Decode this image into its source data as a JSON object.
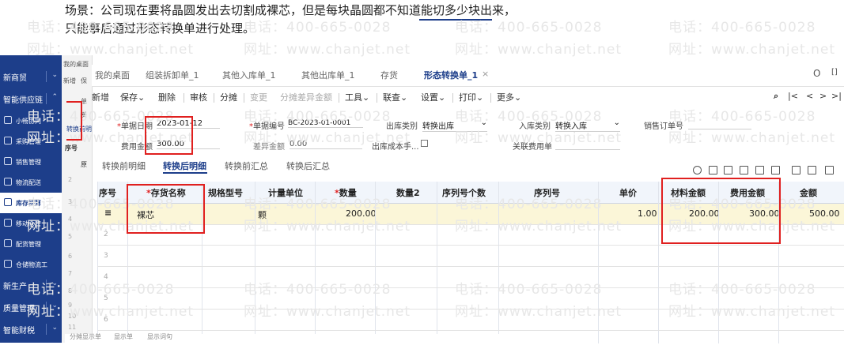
{
  "caption": {
    "line1": "场景：公司现在要将晶圆发出去切割成裸芯，但是每块晶圆都不知道能切多少块出来，",
    "line2": "只能事后通过形态转换单进行处理。"
  },
  "watermark": {
    "phone": "电话：400-665-0028",
    "site": "网址：www.chanjet.net"
  },
  "sidebar": {
    "items": [
      {
        "label": "新商贸",
        "type": "top"
      },
      {
        "label": "智能供应链",
        "type": "top"
      },
      {
        "label": "小畅协同",
        "type": "sub"
      },
      {
        "label": "采购管理",
        "type": "sub"
      },
      {
        "label": "销售管理",
        "type": "sub"
      },
      {
        "label": "物流配送",
        "type": "sub"
      },
      {
        "label": "库存核算",
        "type": "sub-active"
      },
      {
        "label": "移动仓管",
        "type": "sub"
      },
      {
        "label": "配货管理",
        "type": "sub"
      },
      {
        "label": "仓储物流工",
        "type": "sub"
      },
      {
        "label": "新生产",
        "type": "top"
      },
      {
        "label": "质量管理",
        "type": "top"
      },
      {
        "label": "智能财税",
        "type": "top"
      }
    ],
    "strip_labels": [
      "我的桌面",
      "新增",
      "保",
      "单",
      "费",
      "转换前明",
      "序号",
      "原",
      "2",
      "3",
      "4",
      "5",
      "6",
      "7",
      "8",
      "9",
      "10",
      "11"
    ]
  },
  "tabs": [
    {
      "label": "我的桌面"
    },
    {
      "label": "组装拆卸单_1"
    },
    {
      "label": "其他入库单_1"
    },
    {
      "label": "其他出库单_1"
    },
    {
      "label": "存货"
    },
    {
      "label": "形态转换单_1",
      "active": true
    }
  ],
  "tab_close": "×",
  "window_icons": {
    "search": "O",
    "expand": "[]"
  },
  "toolbar": {
    "new": "新增",
    "save": "保存",
    "delete": "删除",
    "audit": "审核",
    "split": "分摊",
    "change": "变更",
    "split_diff": "分摊差异金额",
    "tools": "工具",
    "query": "联查",
    "settings": "设置",
    "print": "打印",
    "more": "更多",
    "caret": "⌄",
    "nav_first": "|<",
    "nav_prev": "<",
    "nav_next": ">",
    "nav_last": ">|"
  },
  "form": {
    "date_label": "单据日期",
    "date_value": "2023-01-12",
    "number_label": "单据编号",
    "number_value": "BC-2023-01-0001",
    "out_type_label": "出库类别",
    "out_type_value": "转换出库",
    "in_type_label": "入库类别",
    "in_type_value": "转换入库",
    "sales_order_label": "销售订单号",
    "fee_label": "费用金额",
    "fee_value": "300.00",
    "diff_label": "差异金额",
    "diff_value": "0.00",
    "cost_manual_label": "出库成本手...",
    "related_fee_label": "关联费用单"
  },
  "subtabs": [
    {
      "label": "转换前明细"
    },
    {
      "label": "转换后明细",
      "active": true
    },
    {
      "label": "转换前汇总"
    },
    {
      "label": "转换后汇总"
    }
  ],
  "grid": {
    "headers": [
      "序号",
      "存货名称",
      "规格型号",
      "计量单位",
      "数量",
      "数量2",
      "序列号个数",
      "序列号",
      "单价",
      "材料金额",
      "费用金额",
      "金额"
    ],
    "row1": {
      "no_icon": "≡",
      "name": "裸芯",
      "unit": "颗",
      "qty": "200.00",
      "price": "1.00",
      "material": "200.00",
      "fee": "300.00",
      "amount": "500.00"
    },
    "row_numbers": [
      "2",
      "3",
      "4",
      "5",
      "6"
    ]
  },
  "bottom_labels": [
    "分摊显示单",
    "显示单",
    "显示词句"
  ]
}
